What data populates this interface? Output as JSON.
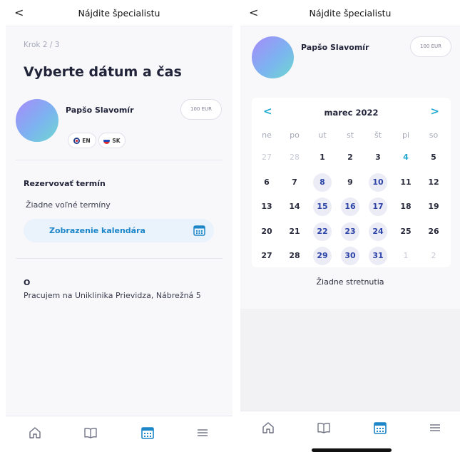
{
  "left": {
    "header": {
      "back": "<",
      "title": "Nájdite špecialistu"
    },
    "step": "Krok 2 / 3",
    "heading": "Vyberte dátum a čas",
    "doctor": {
      "name": "Papšo Slavomír",
      "price": "100 EUR",
      "languages": [
        "EN",
        "SK"
      ]
    },
    "booking": {
      "title": "Rezervovať termín",
      "empty": "Žiadne voľné termíny",
      "calendar_button": "Zobrazenie kalendára"
    },
    "about": {
      "title": "O",
      "text": "Pracujem  na Uniklinika Prievidza,  Nábrežná 5"
    }
  },
  "right": {
    "header": {
      "back": "<",
      "title": "Nájdite špecialistu"
    },
    "doctor": {
      "name": "Papšo Slavomír",
      "price": "100 EUR"
    },
    "calendar": {
      "month": "marec 2022",
      "prev": "<",
      "next": ">",
      "weekdays": [
        "ne",
        "po",
        "ut",
        "st",
        "št",
        "pi",
        "so"
      ],
      "weeks": [
        [
          {
            "d": "27",
            "s": "other"
          },
          {
            "d": "28",
            "s": "other"
          },
          {
            "d": "1",
            "s": "normal"
          },
          {
            "d": "2",
            "s": "normal"
          },
          {
            "d": "3",
            "s": "normal"
          },
          {
            "d": "4",
            "s": "today"
          },
          {
            "d": "5",
            "s": "normal"
          }
        ],
        [
          {
            "d": "6",
            "s": "normal"
          },
          {
            "d": "7",
            "s": "normal"
          },
          {
            "d": "8",
            "s": "avail"
          },
          {
            "d": "9",
            "s": "normal"
          },
          {
            "d": "10",
            "s": "avail"
          },
          {
            "d": "11",
            "s": "normal"
          },
          {
            "d": "12",
            "s": "normal"
          }
        ],
        [
          {
            "d": "13",
            "s": "normal"
          },
          {
            "d": "14",
            "s": "normal"
          },
          {
            "d": "15",
            "s": "avail"
          },
          {
            "d": "16",
            "s": "avail"
          },
          {
            "d": "17",
            "s": "avail"
          },
          {
            "d": "18",
            "s": "normal"
          },
          {
            "d": "19",
            "s": "normal"
          }
        ],
        [
          {
            "d": "20",
            "s": "normal"
          },
          {
            "d": "21",
            "s": "normal"
          },
          {
            "d": "22",
            "s": "avail"
          },
          {
            "d": "23",
            "s": "avail"
          },
          {
            "d": "24",
            "s": "avail"
          },
          {
            "d": "25",
            "s": "normal"
          },
          {
            "d": "26",
            "s": "normal"
          }
        ],
        [
          {
            "d": "27",
            "s": "normal"
          },
          {
            "d": "28",
            "s": "normal"
          },
          {
            "d": "29",
            "s": "avail"
          },
          {
            "d": "30",
            "s": "avail"
          },
          {
            "d": "31",
            "s": "avail"
          },
          {
            "d": "1",
            "s": "other"
          },
          {
            "d": "2",
            "s": "other"
          }
        ]
      ]
    },
    "no_meetings": "Žiadne stretnutia"
  },
  "tabbar": {
    "icons": [
      "home-icon",
      "book-icon",
      "calendar-icon",
      "menu-icon"
    ],
    "active_color": "#1c86c8",
    "inactive_color": "#6b6e80"
  }
}
